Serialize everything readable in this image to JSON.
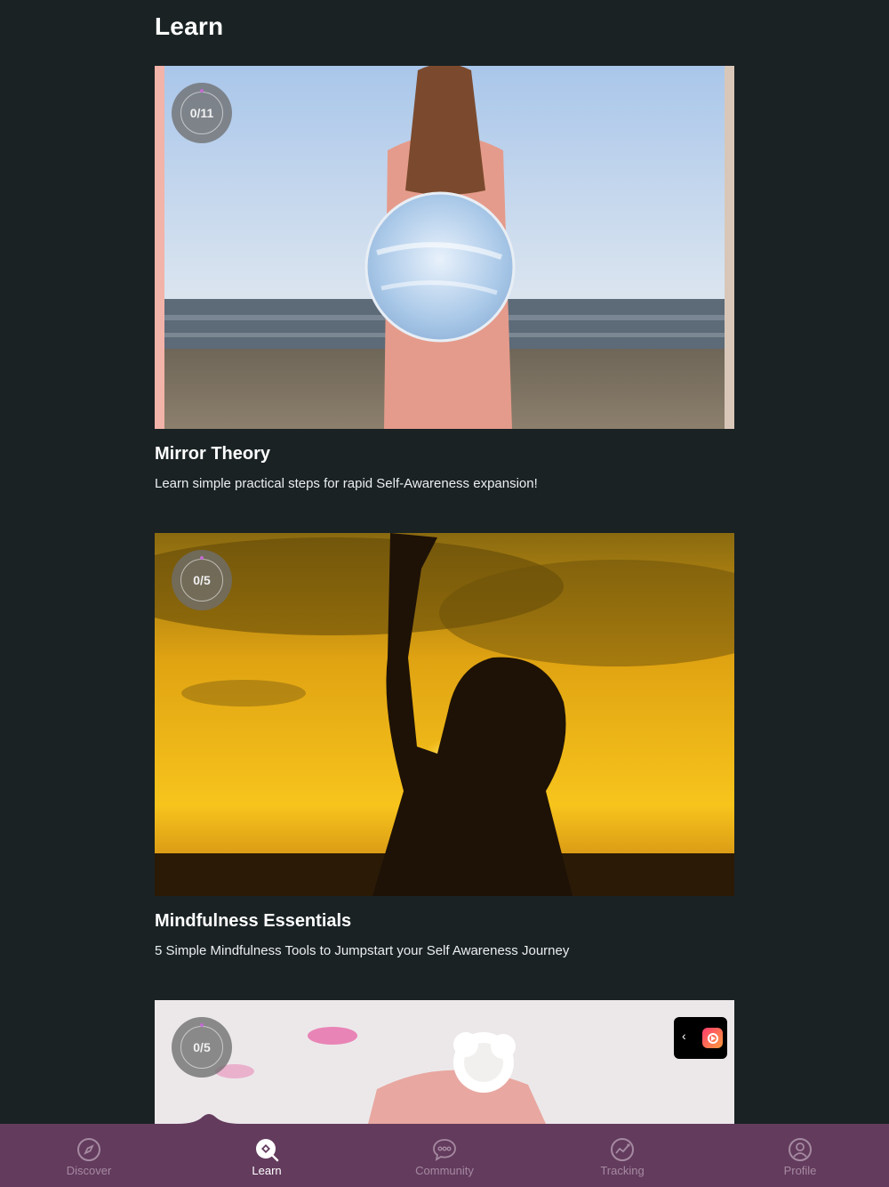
{
  "header": {
    "title": "Learn"
  },
  "courses": [
    {
      "progress": "0/11",
      "title": "Mirror Theory",
      "description": "Learn simple practical steps for rapid Self-Awareness expansion!"
    },
    {
      "progress": "0/5",
      "title": "Mindfulness Essentials",
      "description": "5 Simple Mindfulness Tools to Jumpstart your Self Awareness Journey"
    },
    {
      "progress": "0/5"
    }
  ],
  "floating_widget": {
    "chevron": "‹",
    "icon": "app-logo-icon"
  },
  "nav": {
    "active": "Learn",
    "items": [
      {
        "label": "Discover",
        "icon": "compass-icon"
      },
      {
        "label": "Learn",
        "icon": "learn-icon"
      },
      {
        "label": "Community",
        "icon": "chat-bubble-icon"
      },
      {
        "label": "Tracking",
        "icon": "tracking-chart-icon"
      },
      {
        "label": "Profile",
        "icon": "person-icon"
      }
    ]
  },
  "colors": {
    "background": "#1a2224",
    "nav_background": "#633b5d",
    "progress_accent": "#c16ad0"
  }
}
